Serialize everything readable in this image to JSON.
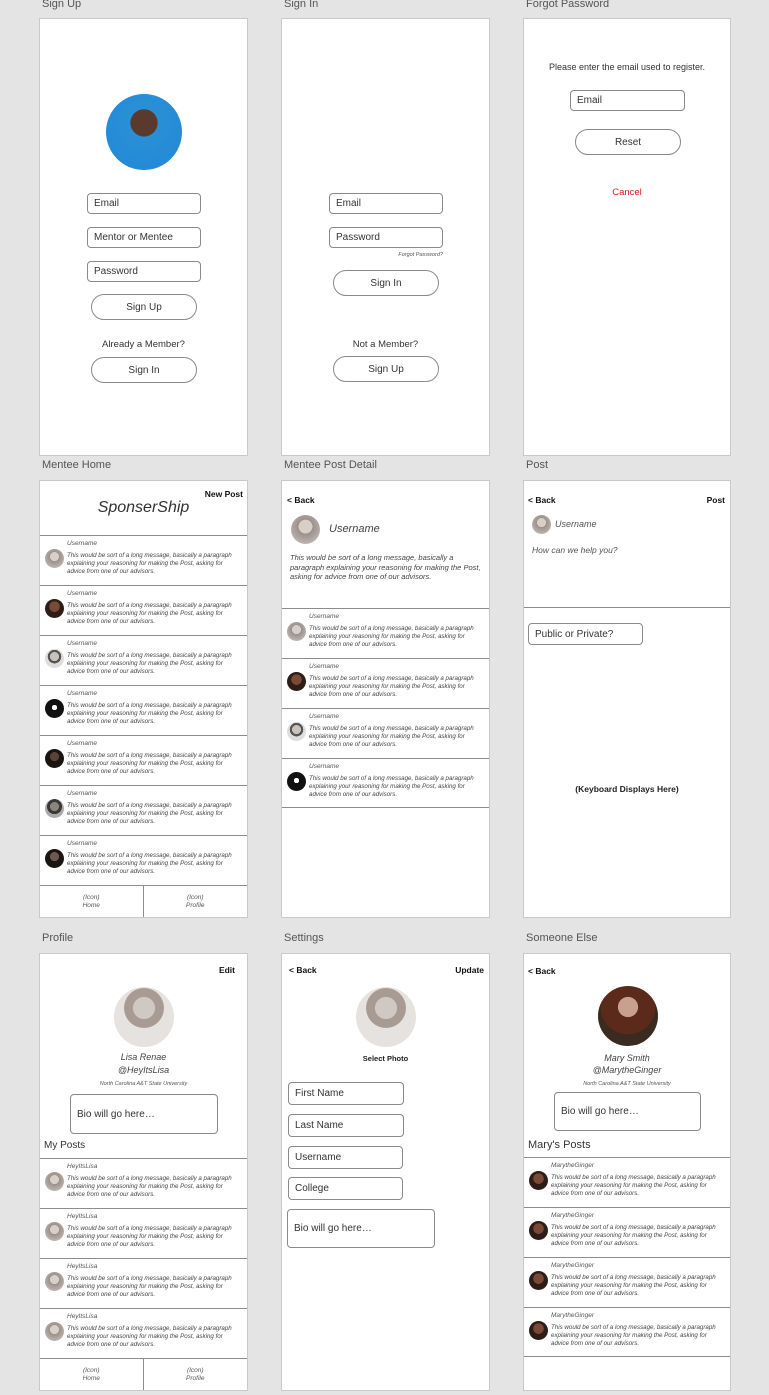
{
  "colors": {
    "cancel": "#e01b1b",
    "artboard_bg": "#ffffff",
    "canvas_bg": "#e4e4e4"
  },
  "post_message": "This would be sort of a long message, basically a paragraph explaining your reasoning for making the Post, asking for advice from one of our advisors.",
  "signup": {
    "label": "Sign Up",
    "email": "Email",
    "role": "Mentor or Mentee",
    "password": "Password",
    "signup_btn": "Sign Up",
    "already": "Already a Member?",
    "signin_btn": "Sign In"
  },
  "signin": {
    "label": "Sign In",
    "email": "Email",
    "password": "Password",
    "forgot": "Forgot Password?",
    "signin_btn": "Sign In",
    "not_member": "Not a Member?",
    "signup_btn": "Sign Up"
  },
  "forgot": {
    "label": "Forgot Password",
    "instructions": "Please enter the email used to register.",
    "email": "Email",
    "reset_btn": "Reset",
    "cancel": "Cancel"
  },
  "mentee_home": {
    "label": "Mentee Home",
    "title": "SponserShip",
    "new_post": "New Post",
    "username": "Username",
    "tabs": [
      "(Icon)\nHome",
      "(Icon)\nProfile"
    ]
  },
  "post_detail": {
    "label": "Mentee Post Detail",
    "back": "< Back",
    "username": "Username",
    "username_small": "Username"
  },
  "post": {
    "label": "Post",
    "back": "< Back",
    "post_btn": "Post",
    "username": "Username",
    "prompt": "How can we help you?",
    "visibility": "Public or Private?",
    "keyboard": "(Keyboard Displays Here)"
  },
  "profile": {
    "label": "Profile",
    "edit": "Edit",
    "name": "Lisa Renae",
    "handle": "@HeyItsLisa",
    "school": "North Carolina A&T State University",
    "bio": "Bio will go here…",
    "my_posts": "My Posts",
    "post_user": "HeyItsLisa",
    "tabs": [
      "(Icon)\nHome",
      "(Icon)\nProfile"
    ]
  },
  "settings": {
    "label": "Settings",
    "back": "< Back",
    "update": "Update",
    "select_photo": "Select Photo",
    "first": "First Name",
    "last": "Last Name",
    "username": "Username",
    "college": "College",
    "bio": "Bio will go here…"
  },
  "someone": {
    "label": "Someone Else",
    "back": "< Back",
    "name": "Mary Smith",
    "handle": "@MarytheGinger",
    "school": "North Carolina A&T State University",
    "bio": "Bio will go here…",
    "posts_title": "Mary's Posts",
    "post_user": "MarytheGinger"
  }
}
